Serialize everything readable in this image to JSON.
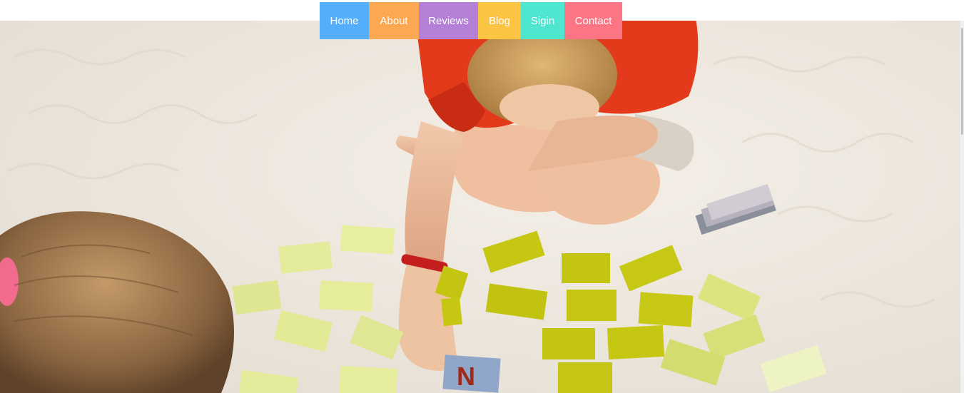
{
  "nav": {
    "items": [
      {
        "label": "Home",
        "color": "#55aefc"
      },
      {
        "label": "About",
        "color": "#fca752"
      },
      {
        "label": "Reviews",
        "color": "#b47fd6"
      },
      {
        "label": "Blog",
        "color": "#fcc443"
      },
      {
        "label": "Sigin",
        "color": "#4ee6cf"
      },
      {
        "label": "Contact",
        "color": "#fb7584"
      }
    ]
  },
  "hero": {
    "image": "children-playing-memory-card-game-photo"
  }
}
